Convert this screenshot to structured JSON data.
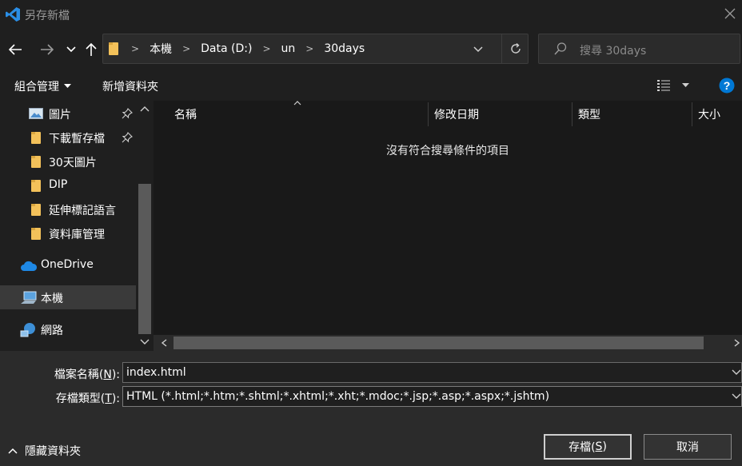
{
  "window": {
    "title": "另存新檔",
    "app_icon": "vscode-logo-icon"
  },
  "address": {
    "breadcrumbs": [
      "本機",
      "Data (D:)",
      "un",
      "30days"
    ]
  },
  "search": {
    "placeholder": "搜尋 30days"
  },
  "toolbar": {
    "organize": "組合管理",
    "new_folder": "新增資料夾"
  },
  "nav": {
    "items": [
      {
        "label": "圖片",
        "icon": "pictures-icon",
        "pinned": true
      },
      {
        "label": "下載暫存檔",
        "icon": "folder-icon",
        "pinned": true
      },
      {
        "label": "30天圖片",
        "icon": "folder-icon"
      },
      {
        "label": "DIP",
        "icon": "folder-icon"
      },
      {
        "label": "延伸標記語言",
        "icon": "folder-icon"
      },
      {
        "label": "資料庫管理",
        "icon": "folder-icon"
      },
      {
        "label": "OneDrive",
        "icon": "onedrive-icon"
      },
      {
        "label": "本機",
        "icon": "this-pc-icon",
        "selected": true
      },
      {
        "label": "網路",
        "icon": "network-icon"
      }
    ]
  },
  "filelist": {
    "columns": [
      "名稱",
      "修改日期",
      "類型",
      "大小"
    ],
    "empty_message": "沒有符合搜尋條件的項目"
  },
  "form": {
    "filename_label": "檔案名稱(",
    "filename_key": "N",
    "filename_value": "index.html",
    "filetype_label": "存檔類型(",
    "filetype_key": "T",
    "filetype_value": "HTML (*.html;*.htm;*.shtml;*.xhtml;*.xht;*.mdoc;*.jsp;*.asp;*.aspx;*.jshtm)",
    "label_suffix": "):"
  },
  "buttons": {
    "save_label": "存檔(",
    "save_key": "S",
    "save_suffix": ")",
    "cancel": "取消"
  },
  "hide_folders": "隱藏資料夾",
  "colors": {
    "background": "#202020",
    "accent": "#0078d4",
    "folder": "#f3c15a"
  }
}
